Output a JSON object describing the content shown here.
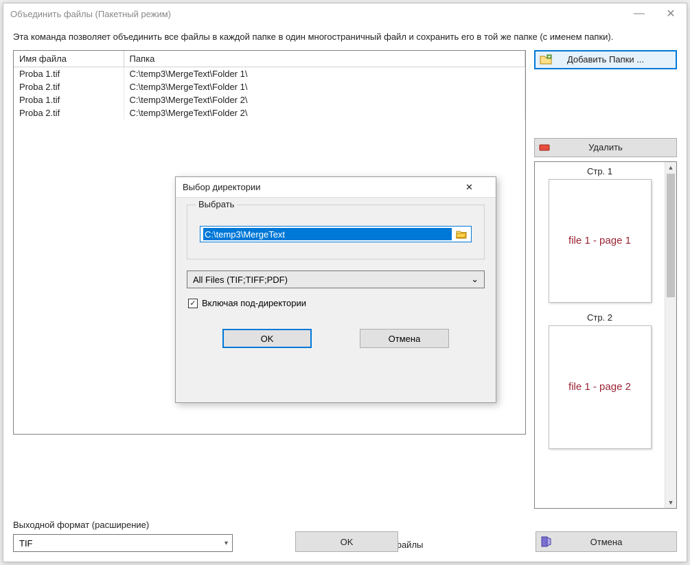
{
  "window": {
    "title": "Объединить файлы (Пакетный режим)"
  },
  "description": "Эта команда позволяет объединить все файлы в каждой папке в один многостраничный файл и сохранить его в той же папке (с именем папки).",
  "table": {
    "col_name": "Имя файла",
    "col_folder": "Папка",
    "rows": [
      {
        "name": "Proba 1.tif",
        "folder": "C:\\temp3\\MergeText\\Folder 1\\"
      },
      {
        "name": "Proba 2.tif",
        "folder": "C:\\temp3\\MergeText\\Folder 1\\"
      },
      {
        "name": "Proba 1.tif",
        "folder": "C:\\temp3\\MergeText\\Folder 2\\"
      },
      {
        "name": "Proba 2.tif",
        "folder": "C:\\temp3\\MergeText\\Folder 2\\"
      }
    ]
  },
  "sidebar": {
    "add_folders": "Добавить Папки ...",
    "delete": "Удалить"
  },
  "preview": {
    "pages": [
      {
        "label": "Стр. 1",
        "content": "file 1 - page 1"
      },
      {
        "label": "Стр. 2",
        "content": "file 1 - page 2"
      }
    ]
  },
  "output": {
    "format_label": "Выходной формат (расширение)",
    "format_value": "TIF",
    "delete_source": "Удалить исходные файлы"
  },
  "buttons": {
    "ok": "OK",
    "cancel": "Отмена"
  },
  "dialog": {
    "title": "Выбор директории",
    "select_label": "Выбрать",
    "path": "C:\\temp3\\MergeText",
    "filter": "All Files (TIF;TIFF;PDF)",
    "include_sub": "Включая под-директории",
    "ok": "OK",
    "cancel": "Отмена"
  }
}
